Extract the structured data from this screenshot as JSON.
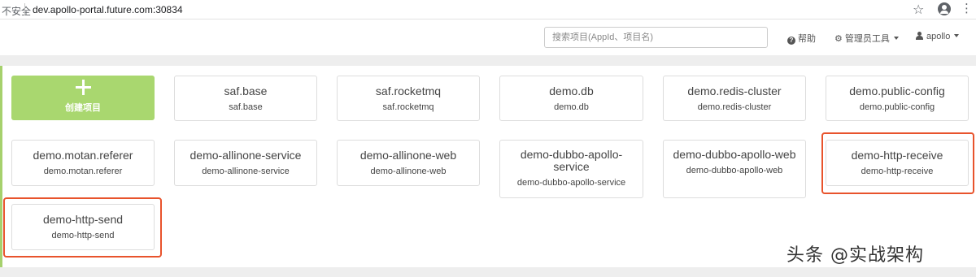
{
  "browser": {
    "security_label": "不安全",
    "url": "dev.apollo-portal.future.com:30834"
  },
  "header": {
    "search_placeholder": "搜索项目(AppId、项目名)",
    "help_label": "帮助",
    "admin_tools_label": "管理员工具",
    "user_label": "apollo"
  },
  "create_project": {
    "label": "创建项目"
  },
  "apps": [
    {
      "name": "saf.base",
      "id": "saf.base"
    },
    {
      "name": "saf.rocketmq",
      "id": "saf.rocketmq"
    },
    {
      "name": "demo.db",
      "id": "demo.db"
    },
    {
      "name": "demo.redis-cluster",
      "id": "demo.redis-cluster"
    },
    {
      "name": "demo.public-config",
      "id": "demo.public-config"
    },
    {
      "name": "demo.motan.referer",
      "id": "demo.motan.referer"
    },
    {
      "name": "demo-allinone-service",
      "id": "demo-allinone-service"
    },
    {
      "name": "demo-allinone-web",
      "id": "demo-allinone-web"
    },
    {
      "name": "demo-dubbo-apollo-service",
      "id": "demo-dubbo-apollo-service"
    },
    {
      "name": "demo-dubbo-apollo-web",
      "id": "demo-dubbo-apollo-web"
    },
    {
      "name": "demo-http-receive",
      "id": "demo-http-receive"
    },
    {
      "name": "demo-http-send",
      "id": "demo-http-send"
    }
  ],
  "highlight_color": "#e8532c",
  "accent_color": "#a9d76f",
  "watermark": "头条 @实战架构"
}
